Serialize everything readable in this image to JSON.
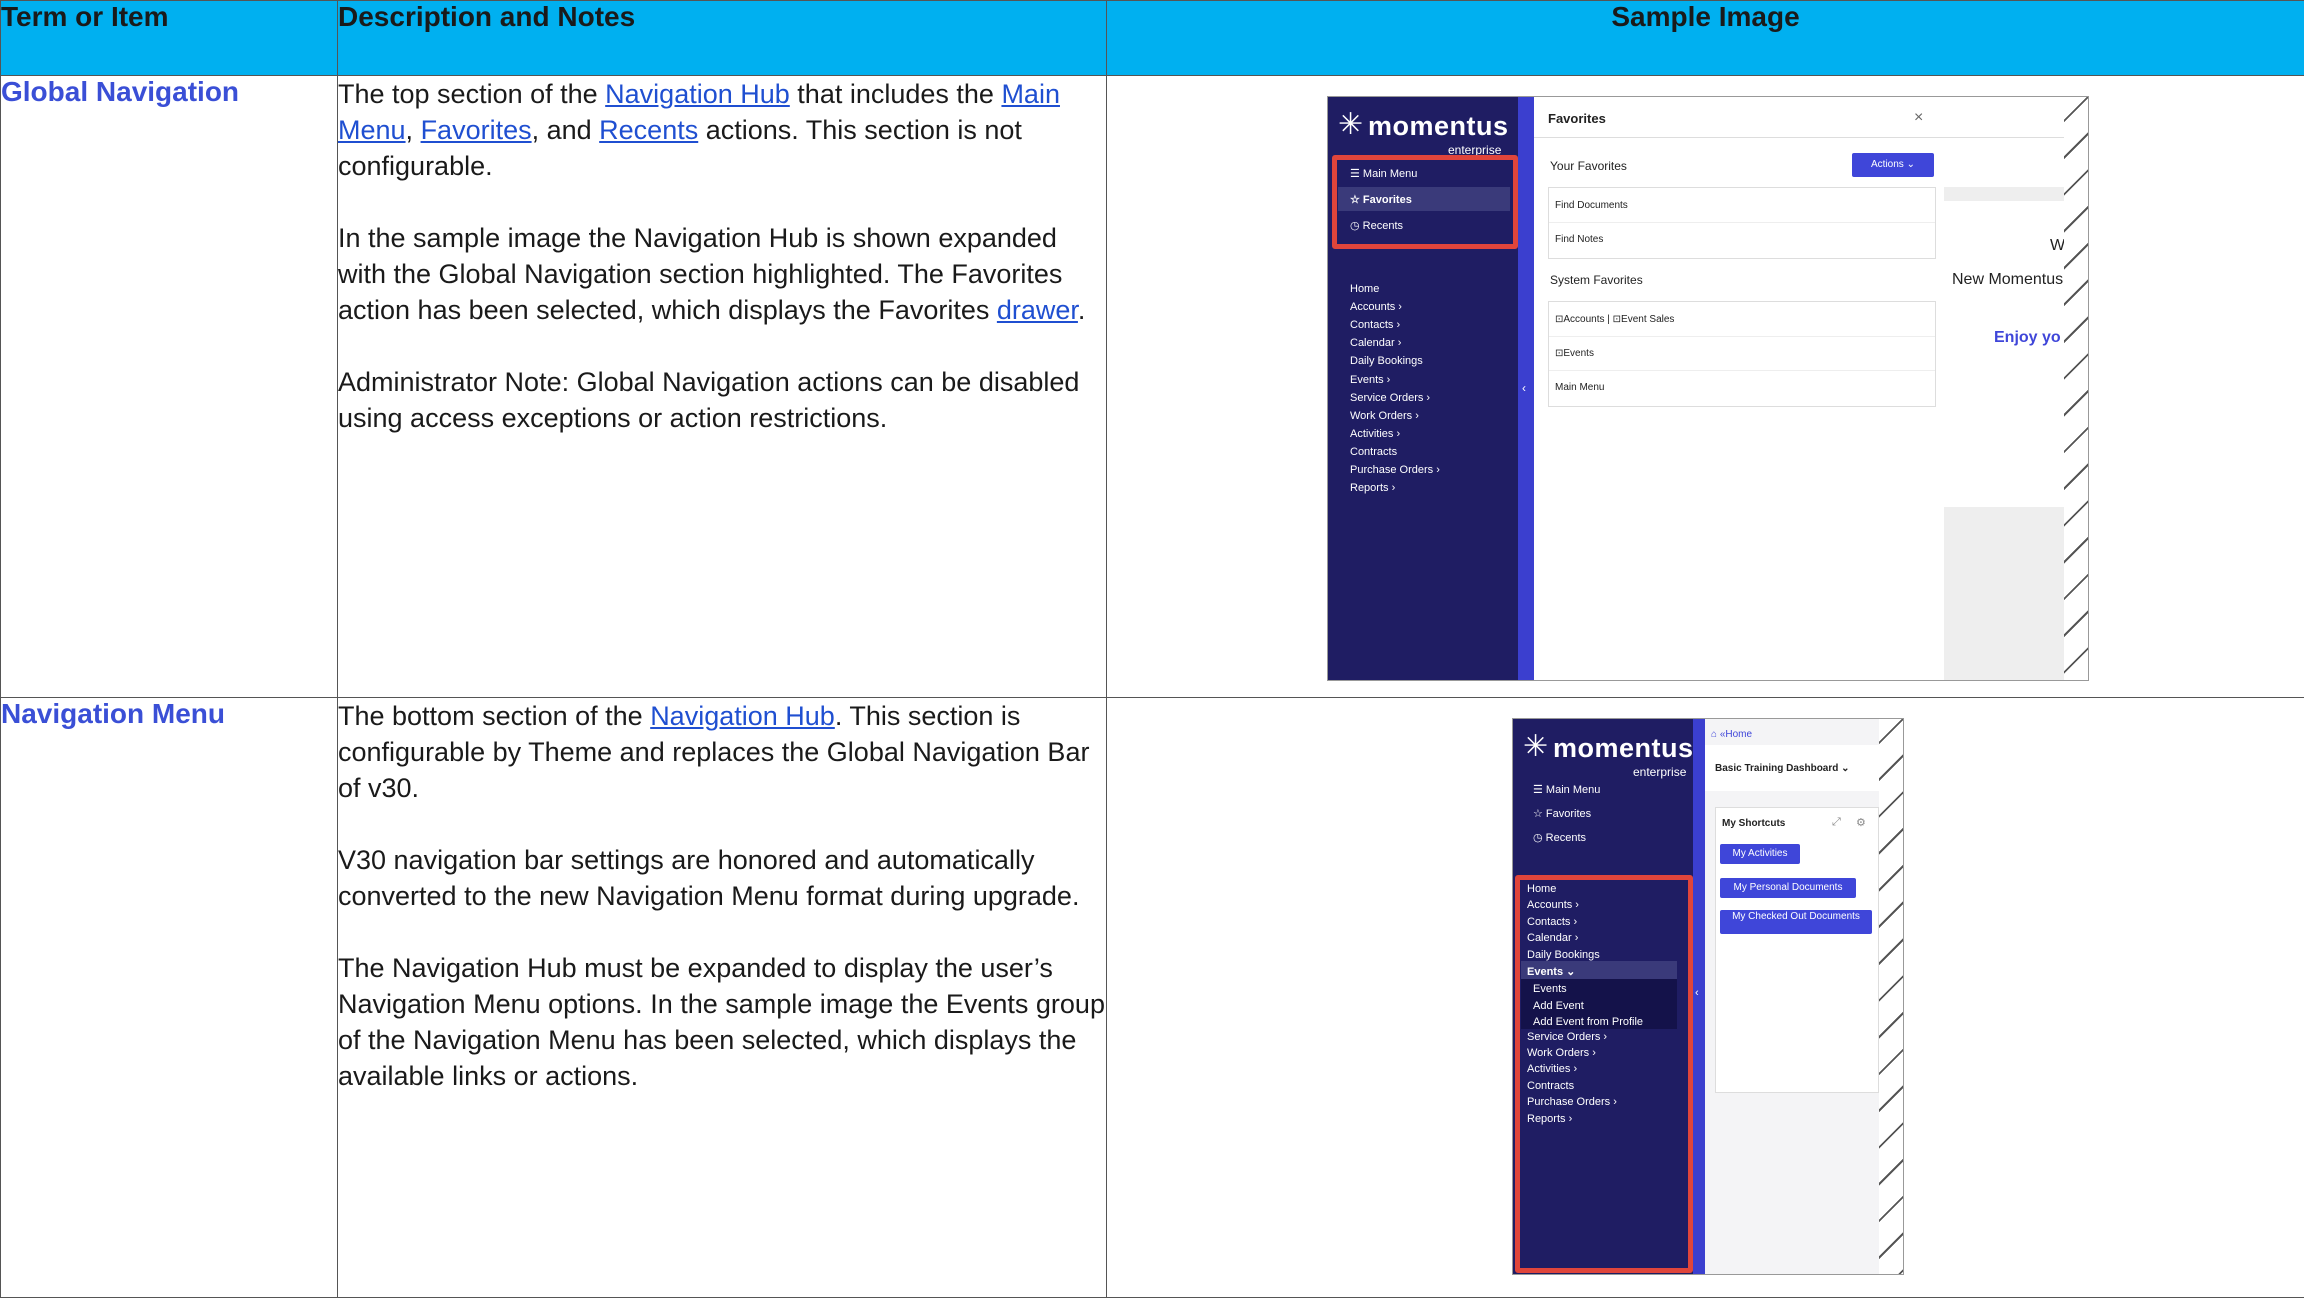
{
  "headers": {
    "term": "Term or Item",
    "desc": "Description and Notes",
    "image": "Sample Image"
  },
  "rows": [
    {
      "term": "Global Navigation",
      "p1": {
        "t1": "The top section of the ",
        "l1": "Navigation Hub",
        "t2": " that includes the ",
        "l2": "Main Menu",
        "t3": ", ",
        "l3": "Favorites",
        "t4": ", and ",
        "l4": "Recents",
        "t5": " actions. This section is not configurable."
      },
      "p2": {
        "t1": "In the sample image the Navigation Hub is shown expanded with the Global Navigation section highlighted. The Favorites action has been selected, which displays the Favorites ",
        "l1": "drawer",
        "t2": "."
      },
      "p3": "Administrator Note: Global Navigation actions can be disabled using access exceptions or action restrictions."
    },
    {
      "term": "Navigation Menu",
      "p1": {
        "t1": "The bottom section of the ",
        "l1": "Navigation Hub",
        "t2": ". This section is configurable by Theme and replaces the Global Navigation Bar of v30."
      },
      "p2": "V30 navigation bar settings are honored and automatically converted to the new Navigation Menu format during upgrade.",
      "p3": "The Navigation Hub must be expanded to display the user’s Navigation Menu options. In the sample image the Events group of the Navigation Menu has been selected, which displays the available links or actions."
    }
  ],
  "app": {
    "logo_mark": "✳",
    "logo_word": "momentus",
    "logo_sub": "enterprise",
    "global_items": [
      "Main Menu",
      "Favorites",
      "Recents"
    ],
    "global_icons": [
      "menu-icon",
      "star-icon",
      "clock-icon"
    ],
    "nav_items": [
      "Home",
      "Accounts",
      "Contacts",
      "Calendar",
      "Daily Bookings",
      "Events",
      "Service Orders",
      "Work Orders",
      "Activities",
      "Contracts",
      "Purchase Orders",
      "Reports"
    ],
    "nav_chevron": "›",
    "collapse_glyph": "‹",
    "highlight_color": "#e0453b",
    "accent_color": "#3f46d9"
  },
  "shot1": {
    "drawer_title": "Favorites",
    "close": "×",
    "your_favorites": "Your Favorites",
    "actions_btn": "Actions ⌄",
    "fav_items": [
      "Find Documents",
      "Find Notes"
    ],
    "system_favorites": "System Favorites",
    "sys_items": [
      "⊡Accounts | ⊡Event Sales",
      "⊡Events",
      "Main Menu"
    ],
    "bg_text_1": "W",
    "bg_text_2": "New Momentus",
    "bg_text_3": "Enjoy yo"
  },
  "shot2": {
    "home_link": "⌂ «Home",
    "dashboard": "Basic Training Dashboard  ⌄",
    "shortcuts_title": "My Shortcuts",
    "shortcut_btns": [
      "My Activities",
      "My Personal Documents",
      "My Checked Out Documents"
    ],
    "events_sub": [
      "Events",
      "Add Event",
      "Add Event from Profile"
    ],
    "events_caret": "⌄"
  }
}
